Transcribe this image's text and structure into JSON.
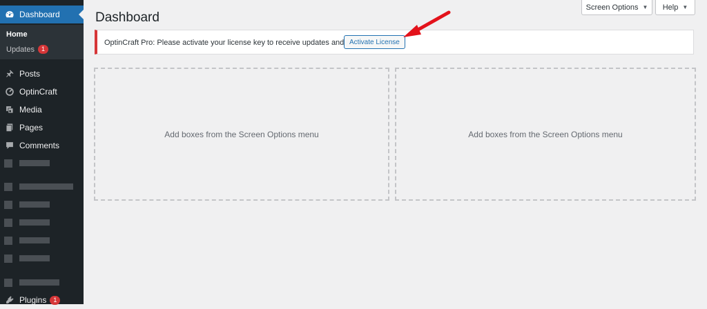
{
  "sidebar": {
    "dashboard": {
      "label": "Dashboard",
      "icon": "dashboard-gauge-icon"
    },
    "submenu": {
      "home": "Home",
      "updates": "Updates",
      "updates_count": "1"
    },
    "items": [
      {
        "label": "Posts",
        "icon": "pushpin-icon"
      },
      {
        "label": "OptinCraft",
        "icon": "optincraft-icon"
      },
      {
        "label": "Media",
        "icon": "media-icon"
      },
      {
        "label": "Pages",
        "icon": "pages-icon"
      },
      {
        "label": "Comments",
        "icon": "comment-icon"
      }
    ],
    "plugins": {
      "label": "Plugins",
      "count": "1",
      "icon": "plugin-icon"
    }
  },
  "header": {
    "title": "Dashboard",
    "screen_options": "Screen Options",
    "help": "Help"
  },
  "notice": {
    "text": "OptinCraft Pro: Please activate your license key to receive updates and support.",
    "button": "Activate License",
    "border_color": "#d63638"
  },
  "boxes": [
    {
      "text": "Add boxes from the Screen Options menu"
    },
    {
      "text": "Add boxes from the Screen Options menu"
    }
  ],
  "colors": {
    "sidebar_bg": "#1d2327",
    "accent": "#2271b1",
    "badge": "#d63638",
    "annotation_arrow": "#e3121b"
  }
}
